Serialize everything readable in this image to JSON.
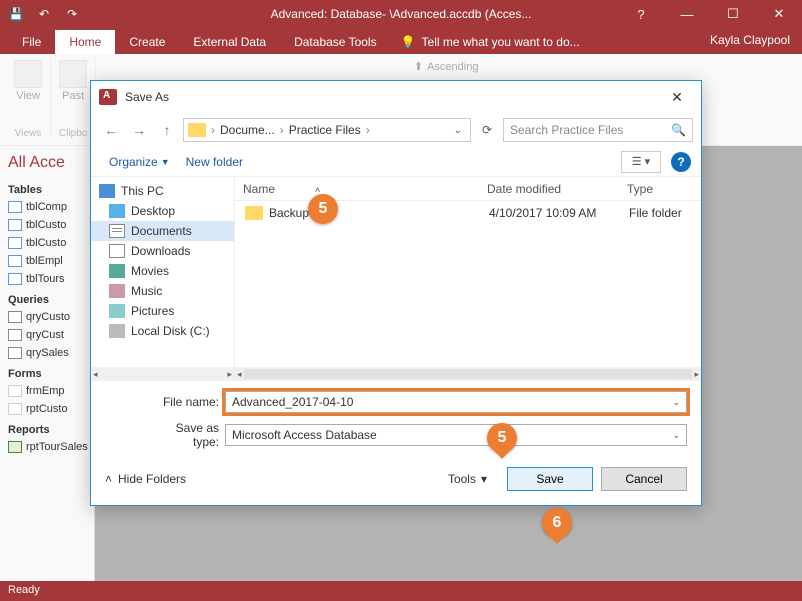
{
  "titlebar": {
    "title": "Advanced: Database- \\Advanced.accdb (Acces..."
  },
  "ribbon": {
    "tabs": [
      "File",
      "Home",
      "Create",
      "External Data",
      "Database Tools"
    ],
    "tell_me": "Tell me what you want to do...",
    "user": "Kayla Claypool",
    "groups": {
      "views": "Views",
      "clipboard": "Clipbo",
      "view_label": "View",
      "paste_label": "Past",
      "ascending": "Ascending"
    }
  },
  "navpane": {
    "title": "All Acce",
    "sections": {
      "tables": {
        "label": "Tables",
        "items": [
          "tblComp",
          "tblCusto",
          "tblCusto",
          "tblEmpl",
          "tblTours"
        ]
      },
      "queries": {
        "label": "Queries",
        "items": [
          "qryCusto",
          "qryCust",
          "qrySales"
        ]
      },
      "forms": {
        "label": "Forms",
        "items": [
          "frmEmp",
          "rptCusto"
        ]
      },
      "reports": {
        "label": "Reports",
        "items": [
          "rptTourSales"
        ]
      }
    }
  },
  "dialog": {
    "title": "Save As",
    "breadcrumb": {
      "parts": [
        "Docume...",
        "Practice Files"
      ]
    },
    "search_placeholder": "Search Practice Files",
    "toolbar": {
      "organize": "Organize",
      "new_folder": "New folder"
    },
    "tree": {
      "items": [
        {
          "label": "This PC",
          "icon": "pc"
        },
        {
          "label": "Desktop",
          "icon": "desk"
        },
        {
          "label": "Documents",
          "icon": "doc",
          "selected": true
        },
        {
          "label": "Downloads",
          "icon": "dl"
        },
        {
          "label": "Movies",
          "icon": "mov"
        },
        {
          "label": "Music",
          "icon": "mus"
        },
        {
          "label": "Pictures",
          "icon": "pic"
        },
        {
          "label": "Local Disk (C:)",
          "icon": "disk"
        }
      ]
    },
    "columns": {
      "name": "Name",
      "date": "Date modified",
      "type": "Type"
    },
    "files": [
      {
        "name": "Backups",
        "date": "4/10/2017 10:09 AM",
        "type": "File folder"
      }
    ],
    "file_name_label": "File name:",
    "file_name_value": "Advanced_2017-04-10",
    "save_type_label": "Save as type:",
    "save_type_value": "Microsoft Access Database",
    "hide_folders": "Hide Folders",
    "tools": "Tools",
    "save": "Save",
    "cancel": "Cancel"
  },
  "statusbar": {
    "text": "Ready"
  },
  "callouts": {
    "c5a": "5",
    "c5b": "5",
    "c6": "6"
  }
}
